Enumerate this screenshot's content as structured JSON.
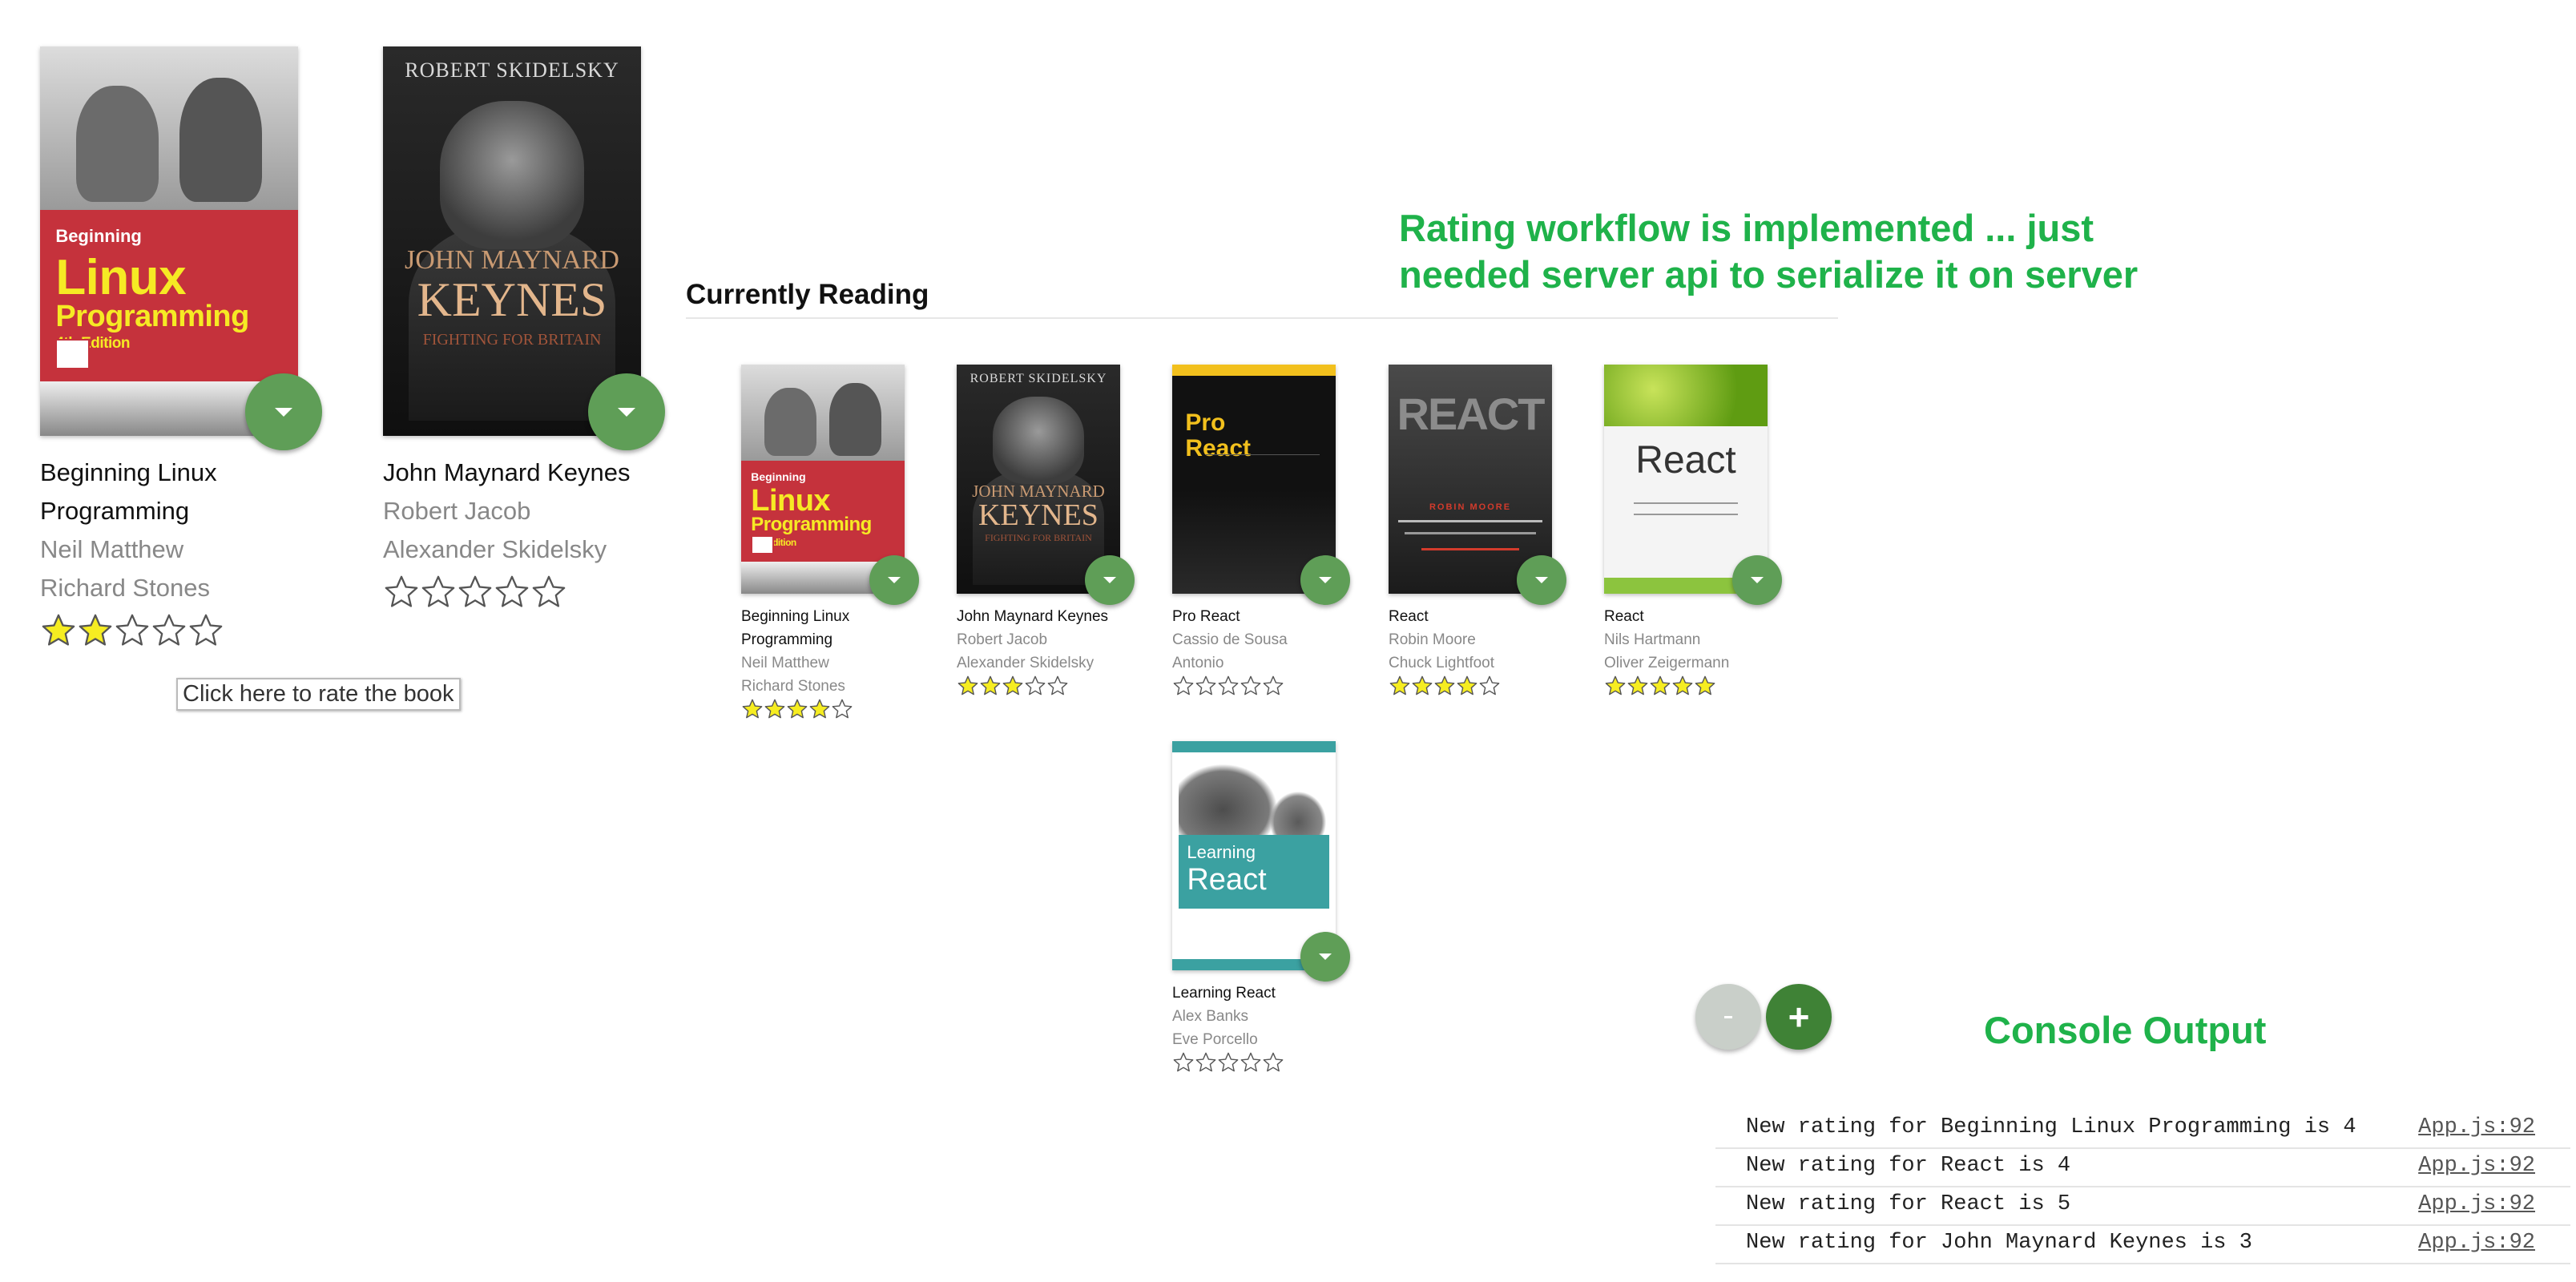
{
  "colors": {
    "fab_green": "#5f9e57",
    "fab_dark_green": "#3f8236",
    "annotation_green": "#1fb24a",
    "star_yellow": "#f6ed21",
    "section_divider": "#e6e6e6"
  },
  "annotation": {
    "line1": "Rating workflow is implemented ... just",
    "line2": "needed server api to serialize it on server"
  },
  "section": {
    "title": "Currently Reading"
  },
  "tooltip": {
    "text": "Click here to rate the book"
  },
  "console_title": "Console Output",
  "console": [
    {
      "message": "New rating for Beginning Linux Programming is 4",
      "source": "App.js:92"
    },
    {
      "message": "New rating for React is 4",
      "source": "App.js:92"
    },
    {
      "message": "New rating for React is 5",
      "source": "App.js:92"
    },
    {
      "message": "New rating for John Maynard Keynes is 3",
      "source": "App.js:92"
    }
  ],
  "cover_text": {
    "linux": {
      "pre": "Beginning",
      "main1": "Linux",
      "main2": "Programming",
      "ed": "4th Edition"
    },
    "keynes": {
      "author": "ROBERT SKIDELSKY",
      "line1": "JOHN MAYNARD",
      "line2": "KEYNES",
      "sub": "FIGHTING FOR BRITAIN"
    },
    "pro": {
      "line1": "Pro",
      "line2": "React"
    },
    "cia": {
      "title": "REACT",
      "author": "ROBIN MOORE"
    },
    "react": {
      "title": "React"
    },
    "learn": {
      "line1": "Learning",
      "line2": "React"
    }
  },
  "preview_books": [
    {
      "title": "Beginning Linux Programming",
      "authors": [
        "Neil Matthew",
        "Richard Stones"
      ],
      "rating": 2,
      "max_rating": 5
    },
    {
      "title": "John Maynard Keynes",
      "authors": [
        "Robert Jacob",
        "Alexander Skidelsky"
      ],
      "rating": 0,
      "max_rating": 5
    }
  ],
  "books": [
    {
      "title": "Beginning Linux Programming",
      "authors": [
        "Neil Matthew",
        "Richard Stones"
      ],
      "rating": 4,
      "max_rating": 5
    },
    {
      "title": "John Maynard Keynes",
      "authors": [
        "Robert Jacob",
        "Alexander Skidelsky"
      ],
      "rating": 3,
      "max_rating": 5
    },
    {
      "title": "Pro React",
      "authors": [
        "Cassio de Sousa",
        "Antonio"
      ],
      "rating": 0,
      "max_rating": 5
    },
    {
      "title": "React",
      "authors": [
        "Robin Moore",
        "Chuck Lightfoot"
      ],
      "rating": 4,
      "max_rating": 5
    },
    {
      "title": "React",
      "authors": [
        "Nils Hartmann",
        "Oliver Zeigermann"
      ],
      "rating": 5,
      "max_rating": 5
    },
    {
      "title": "Learning React",
      "authors": [
        "Alex Banks",
        "Eve Porcello"
      ],
      "rating": 0,
      "max_rating": 5
    }
  ],
  "fab_buttons": {
    "minus_icon": "remove-icon",
    "plus_label": "+"
  }
}
